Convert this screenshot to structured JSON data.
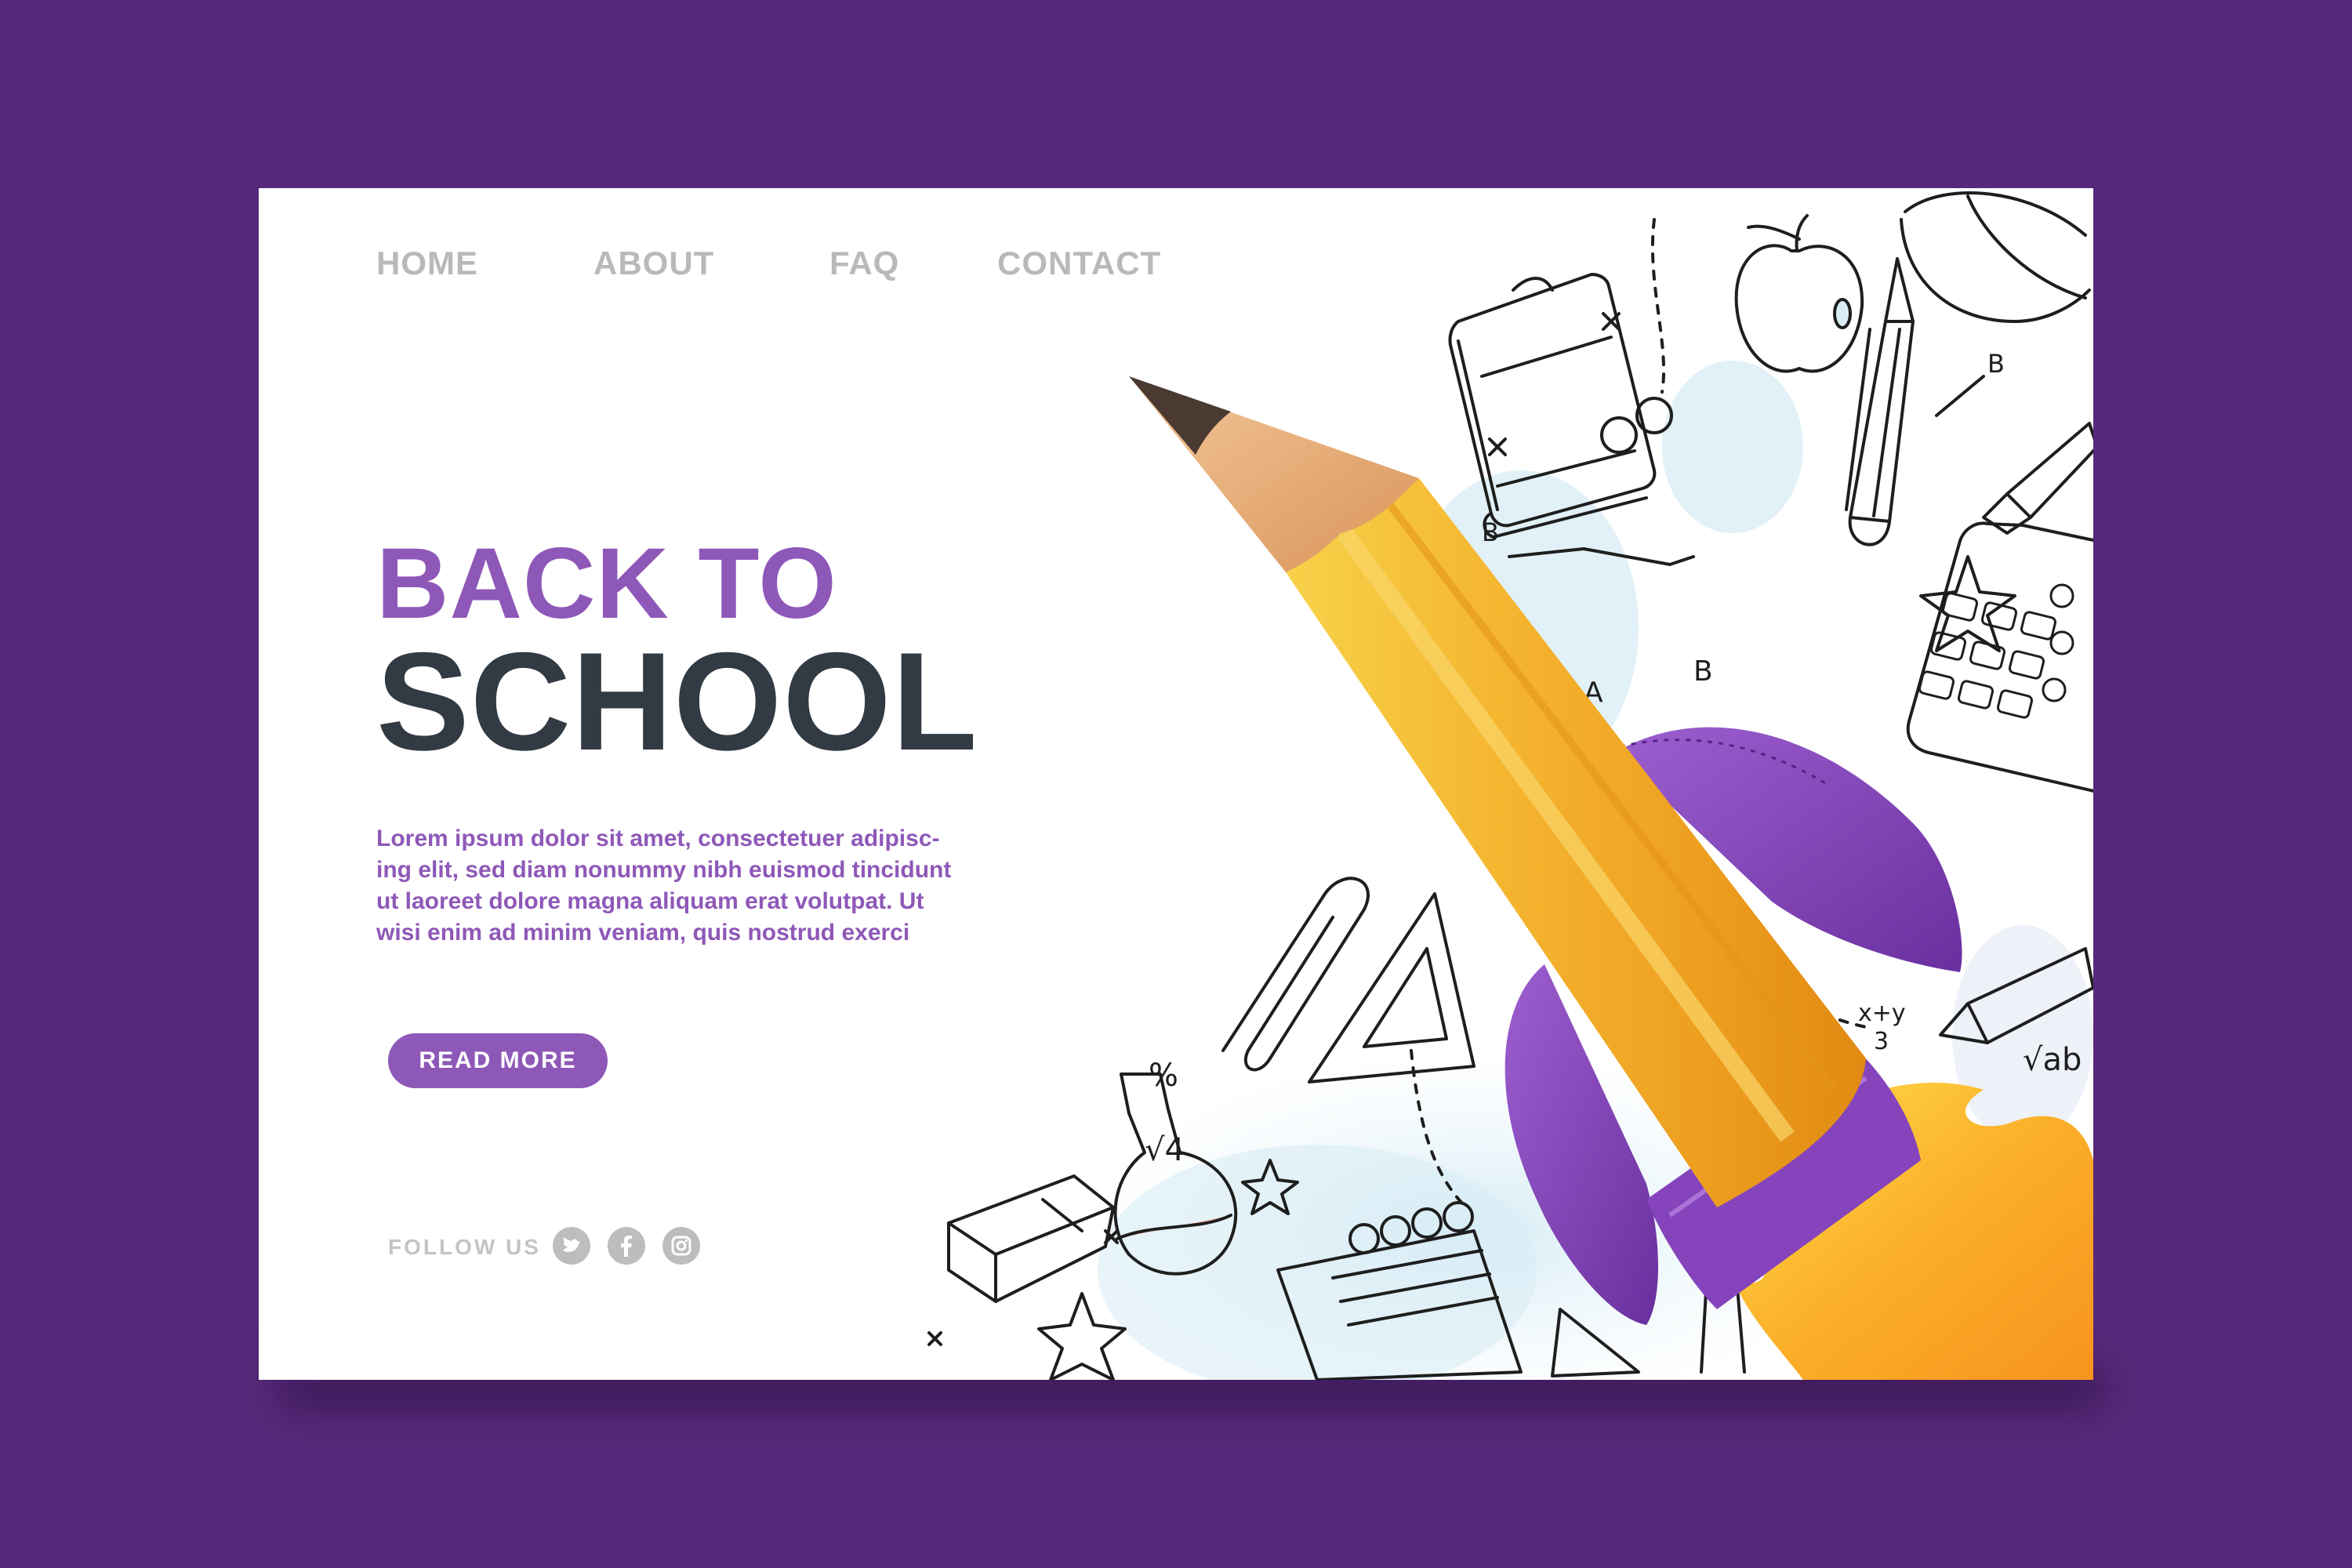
{
  "nav": {
    "items": [
      {
        "label": "HOME"
      },
      {
        "label": "ABOUT"
      },
      {
        "label": "FAQ"
      },
      {
        "label": "CONTACT"
      }
    ]
  },
  "hero": {
    "title_line1": "BACK TO",
    "title_line2": "SCHOOL",
    "body_lines": [
      "Lorem ipsum dolor sit amet, consectetuer adipisc-",
      "ing elit, sed diam nonummy nibh euismod tincidunt",
      "ut laoreet dolore magna aliquam erat volutpat. Ut",
      "wisi enim ad minim veniam, quis nostrud exerci"
    ],
    "cta_label": "READ MORE"
  },
  "social": {
    "label": "FOLLOW US",
    "icons": [
      "twitter-icon",
      "facebook-icon",
      "instagram-icon"
    ]
  },
  "doodle_text": {
    "arrow_a": "A",
    "arrow_b": "B",
    "formula": "x+y",
    "formula_denominator": "3",
    "sqrt_ab": "√ab",
    "sqrt_4": "√4",
    "percent": "%",
    "b_top": "B",
    "b_left": "B"
  },
  "colors": {
    "page_background": "#57297a",
    "accent_purple": "#8e58b8",
    "heading_dark": "#323a44",
    "nav_gray": "#b9b9b9",
    "pencil_yellow": "#f5b731",
    "rocket_purple": "#7a3fb0",
    "flame_orange": "#f7931e"
  }
}
